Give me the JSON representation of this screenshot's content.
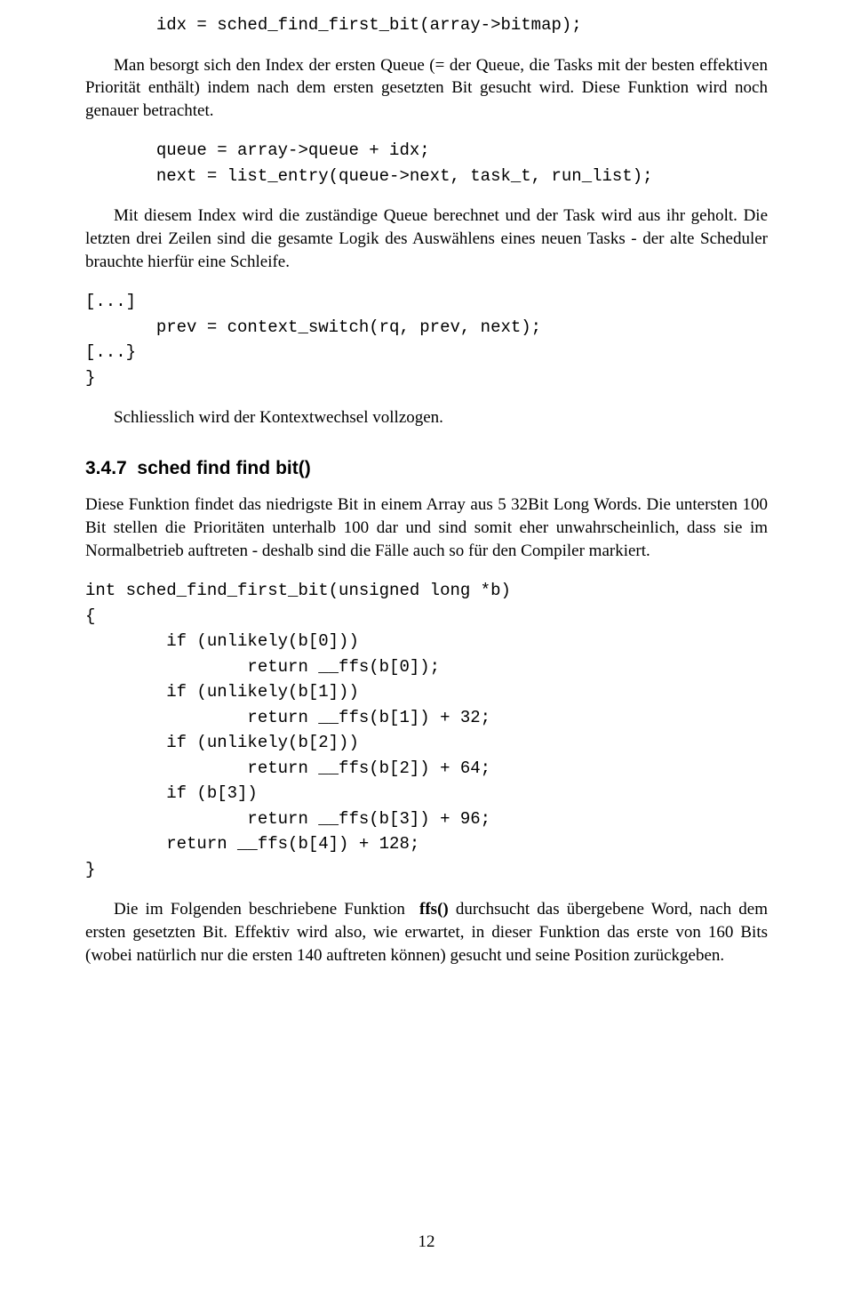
{
  "code1": "       idx = sched_find_first_bit(array->bitmap);",
  "para1": "Man besorgt sich den Index der ersten Queue (= der Queue, die Tasks mit der besten effektiven Priorität enthält) indem nach dem ersten gesetzten Bit gesucht wird. Diese Funktion wird noch genauer betrachtet.",
  "code2": "       queue = array->queue + idx;\n       next = list_entry(queue->next, task_t, run_list);",
  "para2a": "Mit diesem Index wird die zuständige Queue berechnet und der Task wird aus ihr geholt. Die letzten drei Zeilen sind die gesamte Logik des Auswählens eines neuen Tasks - der alte Scheduler brauchte hierfür eine Schleife.",
  "code3": "[...]\n       prev = context_switch(rq, prev, next);\n[...}\n}",
  "para3": "Schliesslich wird der Kontextwechsel vollzogen.",
  "heading": {
    "number": "3.4.7",
    "title": "sched_find_find_bit()"
  },
  "para4": "Diese Funktion findet das niedrigste Bit in einem Array aus 5 32Bit Long Words. Die untersten 100 Bit stellen die Prioritäten unterhalb 100 dar und sind somit eher unwahrscheinlich, dass sie im Normalbetrieb auftreten - deshalb sind die Fälle auch so für den Compiler markiert.",
  "code4": "int sched_find_first_bit(unsigned long *b)\n{\n        if (unlikely(b[0]))\n                return __ffs(b[0]);\n        if (unlikely(b[1]))\n                return __ffs(b[1]) + 32;\n        if (unlikely(b[2]))\n                return __ffs(b[2]) + 64;\n        if (b[3])\n                return __ffs(b[3]) + 96;\n        return __ffs(b[4]) + 128;\n}",
  "para5_pre": "Die im Folgenden beschriebene Funktion ",
  "para5_bold": "__ffs()",
  "para5_post": " durchsucht das übergebene Word, nach dem ersten gesetzten Bit. Effektiv wird also, wie erwartet, in dieser Funktion das erste von 160 Bits (wobei natürlich nur die ersten 140 auftreten können) gesucht und seine Position zurückgeben.",
  "page_number": "12"
}
